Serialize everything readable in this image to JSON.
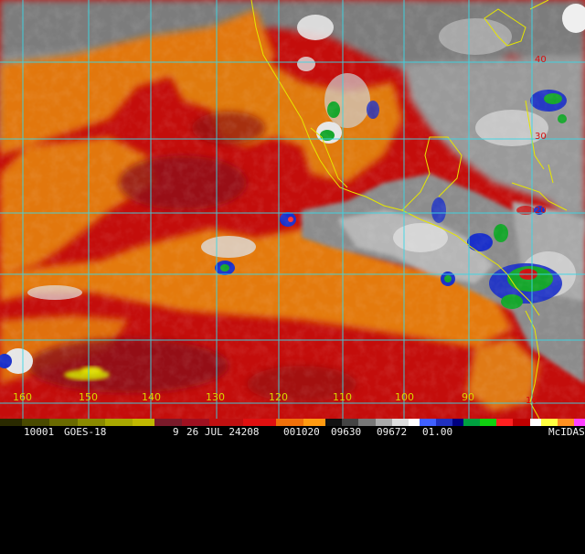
{
  "satellite_image": {
    "longitude_labels": [
      "160",
      "150",
      "140",
      "130",
      "120",
      "110",
      "100",
      "90"
    ],
    "latitude_labels": [
      "40",
      "30",
      "20",
      "10"
    ],
    "colors": {
      "grid": "#39d7e6",
      "coast": "#e6e600",
      "ocean_dry_red": "#c40d0b",
      "ocean_dark_red": "#8e0b16",
      "orange_band": "#e2770c",
      "moist_gray": "#8a8a8a",
      "cloud_white": "#ececec",
      "convective_blue": "#1a2fc9",
      "convective_green": "#16a62c"
    }
  },
  "colorbar": [
    {
      "color": "#2a2a00",
      "w": 20
    },
    {
      "color": "#4a4a00",
      "w": 25
    },
    {
      "color": "#6a6a00",
      "w": 25
    },
    {
      "color": "#8a8a00",
      "w": 25
    },
    {
      "color": "#a8a800",
      "w": 25
    },
    {
      "color": "#c0b800",
      "w": 20
    },
    {
      "color": "#7a1a2a",
      "w": 25
    },
    {
      "color": "#a01020",
      "w": 25
    },
    {
      "color": "#c01010",
      "w": 30
    },
    {
      "color": "#e01010",
      "w": 30
    },
    {
      "color": "#f0700a",
      "w": 25
    },
    {
      "color": "#ff9a10",
      "w": 20
    },
    {
      "color": "#111111",
      "w": 15
    },
    {
      "color": "#444444",
      "w": 15
    },
    {
      "color": "#777777",
      "w": 15
    },
    {
      "color": "#aaaaaa",
      "w": 15
    },
    {
      "color": "#dddddd",
      "w": 15
    },
    {
      "color": "#ffffff",
      "w": 10
    },
    {
      "color": "#4060ff",
      "w": 15
    },
    {
      "color": "#2030c0",
      "w": 15
    },
    {
      "color": "#000080",
      "w": 10
    },
    {
      "color": "#00a040",
      "w": 15
    },
    {
      "color": "#10d010",
      "w": 15
    },
    {
      "color": "#ff2020",
      "w": 15
    },
    {
      "color": "#c00000",
      "w": 15
    },
    {
      "color": "#ffffff",
      "w": 10
    },
    {
      "color": "#ffff40",
      "w": 15
    },
    {
      "color": "#ff9020",
      "w": 15
    },
    {
      "color": "#ff40ff",
      "w": 10
    }
  ],
  "status_bar": {
    "image_id": "10001",
    "satellite": "GOES-18",
    "band": "9",
    "date": "26 JUL 24208",
    "time": "001020",
    "ncols": "09630",
    "nrows": "09672",
    "res": "01.00",
    "software": "McIDAS"
  }
}
